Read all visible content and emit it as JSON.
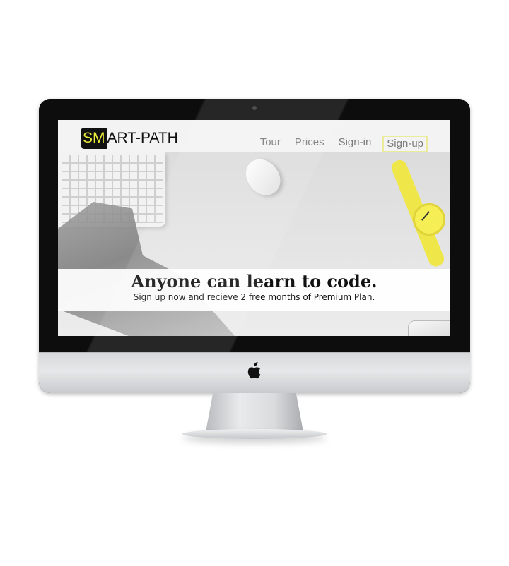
{
  "site": {
    "logo": {
      "highlight": "SM",
      "rest": "ART-PATH"
    },
    "nav": [
      {
        "label": "Tour"
      },
      {
        "label": "Prices"
      },
      {
        "label": "Sign-in"
      },
      {
        "label": "Sign-up"
      }
    ],
    "hero": {
      "headline": "Anyone can learn to code.",
      "subline": "Sign up now and recieve 2 free months of Premium Plan."
    }
  },
  "device": {
    "logo_icon": "apple-icon"
  },
  "colors": {
    "logo_accent": "#ecec3a",
    "logo_bg": "#111111",
    "nav_text": "#7b7b7b",
    "signup_outline": "#eceb9a",
    "watch_yellow": "#efe74a"
  }
}
